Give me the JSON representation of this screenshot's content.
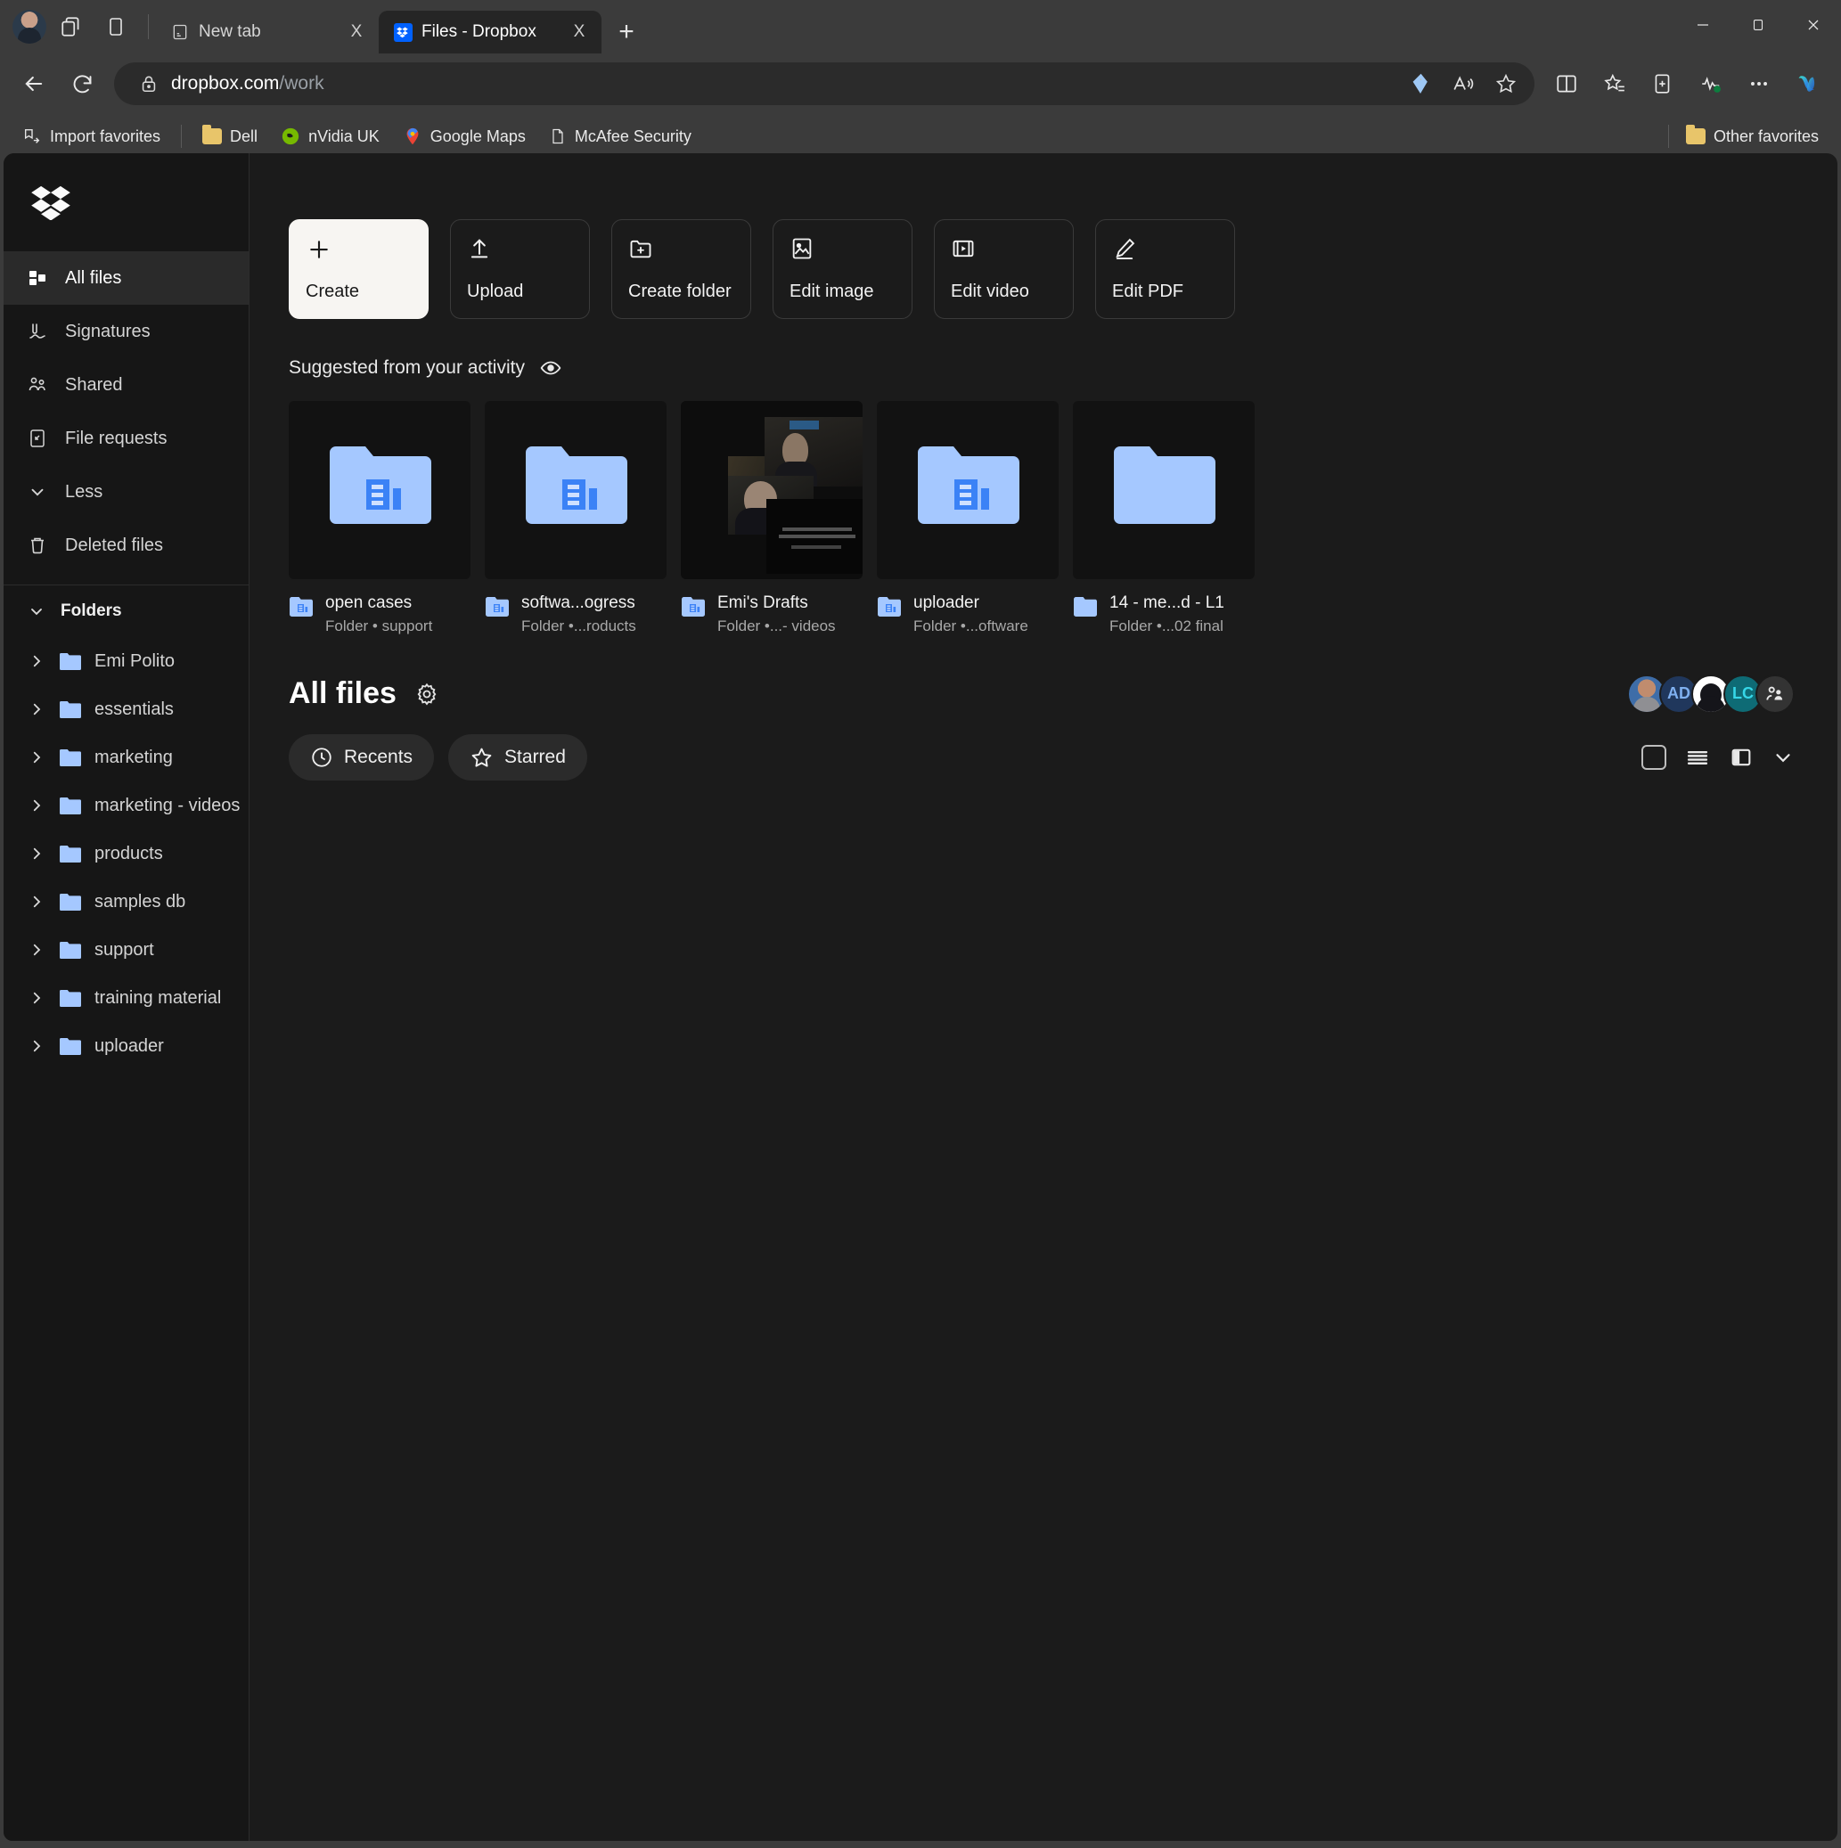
{
  "browser": {
    "tabs": [
      {
        "title": "New tab",
        "favicon": "page-icon",
        "active": false
      },
      {
        "title": "Files - Dropbox",
        "favicon": "dropbox-icon",
        "active": true
      }
    ],
    "new_tab_label": "+",
    "close_label": "X",
    "url_host": "dropbox.com",
    "url_path": "/work",
    "window_controls": {
      "minimize": "–",
      "maximize": "❑",
      "close": "X"
    },
    "bookmarks": [
      {
        "label": "Import favorites",
        "icon": "import-favorites-icon"
      },
      {
        "label": "Dell",
        "icon": "folder-icon"
      },
      {
        "label": "nVidia UK",
        "icon": "nvidia-icon"
      },
      {
        "label": "Google Maps",
        "icon": "google-maps-pin-icon"
      },
      {
        "label": "McAfee Security",
        "icon": "page-icon"
      }
    ],
    "other_favorites": {
      "label": "Other favorites",
      "icon": "folder-icon"
    }
  },
  "sidebar": {
    "logo": "dropbox-logo",
    "nav": [
      {
        "label": "All files",
        "icon": "all-files-icon",
        "active": true
      },
      {
        "label": "Signatures",
        "icon": "signature-icon",
        "active": false
      },
      {
        "label": "Shared",
        "icon": "shared-people-icon",
        "active": false
      },
      {
        "label": "File requests",
        "icon": "file-request-icon",
        "active": false
      },
      {
        "label": "Less",
        "icon": "chevron-down-icon",
        "active": false
      },
      {
        "label": "Deleted files",
        "icon": "trash-icon",
        "active": false
      }
    ],
    "folders_header": "Folders",
    "folders": [
      {
        "label": "Emi Polito"
      },
      {
        "label": "essentials"
      },
      {
        "label": "marketing"
      },
      {
        "label": "marketing - videos"
      },
      {
        "label": "products"
      },
      {
        "label": "samples db"
      },
      {
        "label": "support"
      },
      {
        "label": "training material"
      },
      {
        "label": "uploader"
      }
    ]
  },
  "main": {
    "actions": [
      {
        "label": "Create",
        "icon": "plus-icon",
        "primary": true
      },
      {
        "label": "Upload",
        "icon": "upload-arrow-icon",
        "primary": false
      },
      {
        "label": "Create folder",
        "icon": "folder-plus-icon",
        "primary": false
      },
      {
        "label": "Edit image",
        "icon": "image-icon",
        "primary": false
      },
      {
        "label": "Edit video",
        "icon": "film-play-icon",
        "primary": false
      },
      {
        "label": "Edit PDF",
        "icon": "pencil-icon",
        "primary": false
      }
    ],
    "suggested": {
      "title": "Suggested from your activity",
      "eye_icon": "eye-icon",
      "items": [
        {
          "name": "open cases",
          "sub": "Folder • support",
          "thumb": "shared-folder-icon"
        },
        {
          "name": "softwa...ogress",
          "sub": "Folder •...roducts",
          "thumb": "shared-folder-icon"
        },
        {
          "name": "Emi's Drafts",
          "sub": "Folder •...- videos",
          "thumb": "video-preview"
        },
        {
          "name": "uploader",
          "sub": "Folder •...oftware",
          "thumb": "shared-folder-icon"
        },
        {
          "name": "14 - me...d - L1",
          "sub": "Folder •...02 final",
          "thumb": "plain-folder-icon"
        }
      ]
    },
    "files_section": {
      "title": "All files",
      "settings_icon": "gear-icon",
      "members": [
        {
          "type": "photo",
          "label": ""
        },
        {
          "type": "initials",
          "label": "AD",
          "color": "#20375c"
        },
        {
          "type": "photo",
          "label": ""
        },
        {
          "type": "initials",
          "label": "LC",
          "color": "#0e6b75"
        },
        {
          "type": "invite",
          "label": "",
          "icon": "add-people-icon"
        }
      ],
      "filters": [
        {
          "label": "Recents",
          "icon": "clock-icon"
        },
        {
          "label": "Starred",
          "icon": "star-icon"
        }
      ],
      "view_controls": [
        {
          "icon": "grid-view-icon"
        },
        {
          "icon": "list-view-icon"
        },
        {
          "icon": "split-panel-icon"
        },
        {
          "icon": "chevron-down-icon"
        }
      ]
    }
  },
  "colors": {
    "accent_blue": "#0061ff",
    "folder_blue": "#a5c8ff",
    "page_bg": "#1b1b1b",
    "sidebar_bg": "#161616",
    "chrome_bg": "#3b3b3b"
  }
}
